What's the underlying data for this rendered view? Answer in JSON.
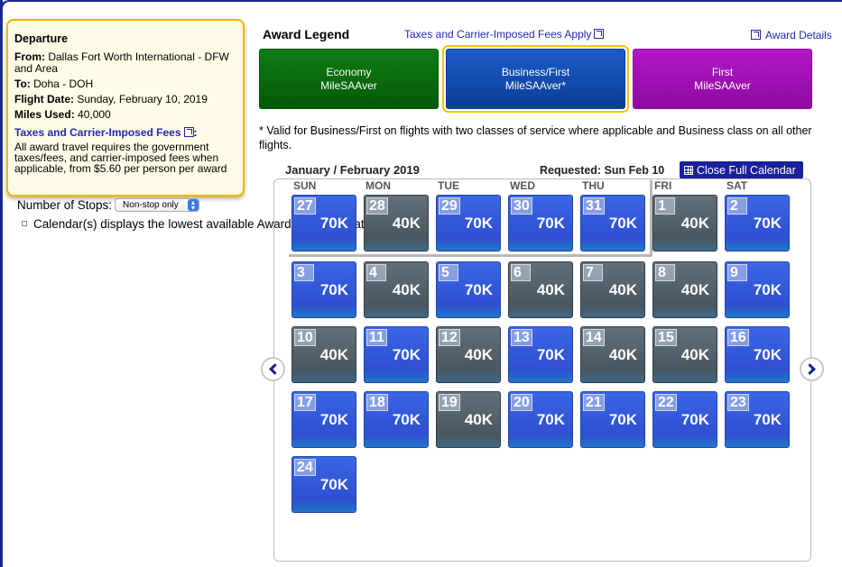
{
  "departure": {
    "title": "Departure",
    "from_label": "From:",
    "from_value": "Dallas Fort Worth International - DFW and Area",
    "to_label": "To:",
    "to_value": "Doha - DOH",
    "date_label": "Flight Date:",
    "date_value": "Sunday, February 10, 2019",
    "miles_label": "Miles Used:",
    "miles_value": "40,000",
    "fees_link": "Taxes and Carrier-Imposed Fees",
    "fees_colon": ":",
    "fees_text": "All award travel requires the government taxes/fees, and carrier-imposed fees when applicable, from $5.60 per person per award"
  },
  "stops": {
    "label": "Number of Stops:",
    "selected": "Non-stop only"
  },
  "calendar_note": "Calendar(s) displays the lowest available Award Miles for that day",
  "legend": {
    "title": "Award Legend",
    "fees_link": "Taxes and Carrier-Imposed Fees Apply",
    "award_details": "Award Details",
    "economy_l1": "Economy",
    "economy_l2": "MileSAAver",
    "business_l1": "Business/First",
    "business_l2": "MileSAAver*",
    "first_l1": "First",
    "first_l2": "MileSAAver",
    "colors": {
      "economy": "#0a6e0e",
      "business": "#1450b8",
      "first": "#a010b8"
    }
  },
  "valid_note": "* Valid for Business/First on flights with two classes of service where applicable and Business class on all other flights.",
  "calendar": {
    "month": "January / February 2019",
    "requested": "Requested: Sun Feb 10",
    "close_label": "Close Full Calendar",
    "weekdays": [
      "SUN",
      "MON",
      "TUE",
      "WED",
      "THU",
      "FRI",
      "SAT"
    ],
    "days": [
      {
        "num": "27",
        "miles": "70K",
        "cls": "blue"
      },
      {
        "num": "28",
        "miles": "40K",
        "cls": "gray"
      },
      {
        "num": "29",
        "miles": "70K",
        "cls": "blue"
      },
      {
        "num": "30",
        "miles": "70K",
        "cls": "blue"
      },
      {
        "num": "31",
        "miles": "70K",
        "cls": "blue"
      },
      {
        "num": "1",
        "miles": "40K",
        "cls": "gray"
      },
      {
        "num": "2",
        "miles": "70K",
        "cls": "blue"
      },
      {
        "num": "3",
        "miles": "70K",
        "cls": "blue"
      },
      {
        "num": "4",
        "miles": "40K",
        "cls": "gray"
      },
      {
        "num": "5",
        "miles": "70K",
        "cls": "blue"
      },
      {
        "num": "6",
        "miles": "40K",
        "cls": "gray"
      },
      {
        "num": "7",
        "miles": "40K",
        "cls": "gray"
      },
      {
        "num": "8",
        "miles": "40K",
        "cls": "gray"
      },
      {
        "num": "9",
        "miles": "70K",
        "cls": "blue"
      },
      {
        "num": "10",
        "miles": "40K",
        "cls": "gray"
      },
      {
        "num": "11",
        "miles": "70K",
        "cls": "blue"
      },
      {
        "num": "12",
        "miles": "40K",
        "cls": "gray"
      },
      {
        "num": "13",
        "miles": "70K",
        "cls": "blue"
      },
      {
        "num": "14",
        "miles": "40K",
        "cls": "gray"
      },
      {
        "num": "15",
        "miles": "40K",
        "cls": "gray"
      },
      {
        "num": "16",
        "miles": "70K",
        "cls": "blue"
      },
      {
        "num": "17",
        "miles": "70K",
        "cls": "blue"
      },
      {
        "num": "18",
        "miles": "70K",
        "cls": "blue"
      },
      {
        "num": "19",
        "miles": "40K",
        "cls": "gray"
      },
      {
        "num": "20",
        "miles": "70K",
        "cls": "blue"
      },
      {
        "num": "21",
        "miles": "70K",
        "cls": "blue"
      },
      {
        "num": "22",
        "miles": "70K",
        "cls": "blue"
      },
      {
        "num": "23",
        "miles": "70K",
        "cls": "blue"
      },
      {
        "num": "24",
        "miles": "70K",
        "cls": "blue"
      }
    ]
  }
}
